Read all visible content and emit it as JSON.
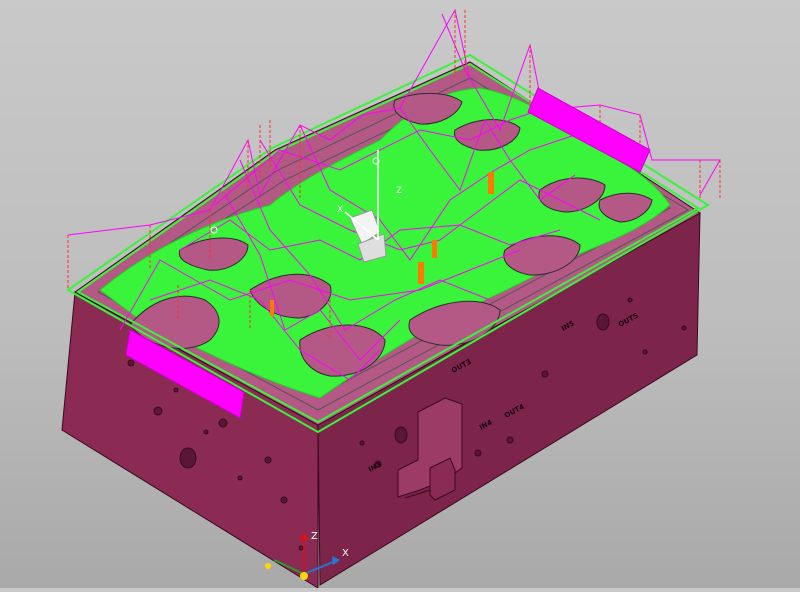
{
  "viewport": {
    "background_color": "#c4c4c4",
    "block_colors": {
      "top_edge": "#b55b87",
      "front_face": "#8a2a52",
      "right_face": "#7a2448",
      "toolpath_green": "#39f43a",
      "toolpath_magenta": "#ff00ff",
      "feed_lines": "#ff3a3a",
      "contours": "#5a5a5a"
    },
    "face_labels": {
      "in3": "IN3",
      "in4": "IN4",
      "out4": "OUT4",
      "out3": "OUT3",
      "in5": "IN5",
      "out5": "OUT5"
    },
    "local_triad": {
      "x": "X",
      "z": "Z"
    },
    "world_triad": {
      "z": "Z",
      "x": "X"
    }
  }
}
